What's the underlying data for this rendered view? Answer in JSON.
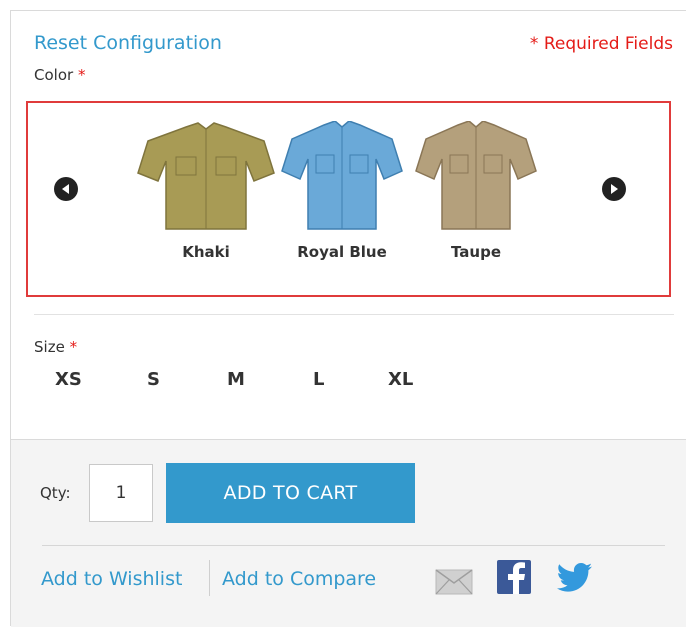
{
  "header": {
    "reset_label": "Reset Configuration",
    "required_label": "* Required Fields"
  },
  "color": {
    "label": "Color",
    "required_mark": "*",
    "swatches": [
      {
        "name": "Khaki",
        "color": "#a89b55"
      },
      {
        "name": "Royal Blue",
        "color": "#6aa9d8"
      },
      {
        "name": "Taupe",
        "color": "#b4a07c"
      }
    ]
  },
  "size": {
    "label": "Size",
    "required_mark": "*",
    "options": [
      "XS",
      "S",
      "M",
      "L",
      "XL"
    ]
  },
  "cart": {
    "qty_label": "Qty:",
    "qty_value": "1",
    "add_label": "ADD TO CART"
  },
  "links": {
    "wishlist": "Add to Wishlist",
    "compare": "Add to Compare"
  },
  "colors": {
    "accent": "#3399cc",
    "required": "#e41b17",
    "selection_border": "#e03b3b"
  },
  "icons": [
    "email-icon",
    "facebook-icon",
    "twitter-icon",
    "arrow-left-icon",
    "arrow-right-icon"
  ]
}
